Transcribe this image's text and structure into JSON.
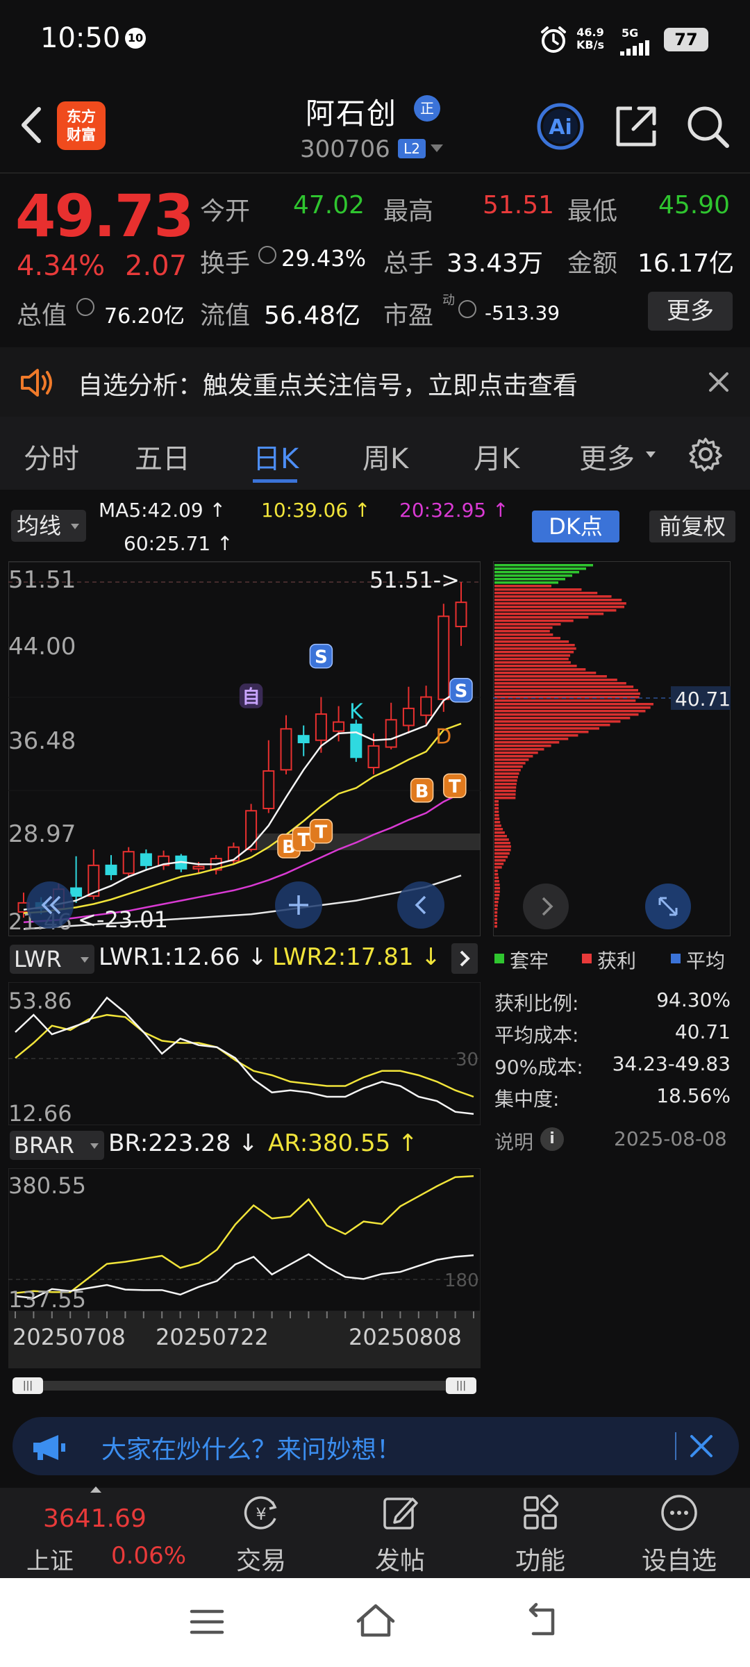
{
  "status_bar": {
    "time": "10:50",
    "badge": "10",
    "net_speed_value": "46.9",
    "net_speed_unit": "KB/s",
    "signal": "5G",
    "battery": "77"
  },
  "header": {
    "logo_line1": "东方",
    "logo_line2": "财富",
    "stock_name": "阿石创",
    "name_badge": "正",
    "stock_code": "300706",
    "level_badge": "L2"
  },
  "quote": {
    "price": "49.73",
    "change_pct": "4.34%",
    "change": "2.07",
    "open_label": "今开",
    "open": "47.02",
    "high_label": "最高",
    "high": "51.51",
    "low_label": "最低",
    "low": "45.90",
    "turnover_label": "换手",
    "turnover": "29.43%",
    "volume_label": "总手",
    "volume": "33.43万",
    "amount_label": "金额",
    "amount": "16.17亿",
    "mktcap_label": "总值",
    "mktcap": "76.20亿",
    "float_label": "流值",
    "float_cap": "56.48亿",
    "pe_label": "市盈",
    "pe_sup": "动",
    "pe": "-513.39",
    "more_label": "更多"
  },
  "banner": {
    "text": "自选分析：触发重点关注信号，立即点击查看"
  },
  "tabs": [
    "分时",
    "五日",
    "日K",
    "周K",
    "月K",
    "更多"
  ],
  "active_tab": 2,
  "ma_row": {
    "select_label": "均线",
    "ma5": "MA5:42.09",
    "ma10": "10:39.06",
    "ma20": "20:32.95",
    "ma60": "60:25.71",
    "up": "↑",
    "dk_label": "DK点",
    "adjust_label": "前复权"
  },
  "kline": {
    "y_labels": [
      "51.51",
      "44.00",
      "36.48",
      "28.97",
      "21.46"
    ],
    "high_marker": "51.51->",
    "low_marker": "<-23.01",
    "markers": [
      "自",
      "S",
      "K",
      "S",
      "B",
      "T",
      "T",
      "B",
      "T",
      "D"
    ],
    "candles": [
      {
        "o": 22.5,
        "c": 23.3,
        "h": 24.2,
        "l": 22.0
      },
      {
        "o": 23.3,
        "c": 22.8,
        "h": 23.8,
        "l": 22.3
      },
      {
        "o": 22.8,
        "c": 24.5,
        "h": 25.0,
        "l": 22.6
      },
      {
        "o": 24.6,
        "c": 23.9,
        "h": 27.4,
        "l": 23.3
      },
      {
        "o": 23.9,
        "c": 26.6,
        "h": 28.0,
        "l": 23.6
      },
      {
        "o": 26.6,
        "c": 25.8,
        "h": 27.5,
        "l": 25.3
      },
      {
        "o": 25.9,
        "c": 27.8,
        "h": 28.2,
        "l": 25.5
      },
      {
        "o": 27.6,
        "c": 26.6,
        "h": 28.0,
        "l": 26.2
      },
      {
        "o": 26.6,
        "c": 27.4,
        "h": 27.9,
        "l": 26.2
      },
      {
        "o": 27.4,
        "c": 26.3,
        "h": 27.6,
        "l": 26.0
      },
      {
        "o": 26.3,
        "c": 26.5,
        "h": 26.9,
        "l": 25.9
      },
      {
        "o": 26.2,
        "c": 27.2,
        "h": 27.5,
        "l": 25.8
      },
      {
        "o": 27.0,
        "c": 28.2,
        "h": 28.6,
        "l": 26.7
      },
      {
        "o": 28.0,
        "c": 31.4,
        "h": 32.0,
        "l": 27.8
      },
      {
        "o": 31.6,
        "c": 34.9,
        "h": 37.6,
        "l": 31.2
      },
      {
        "o": 35.0,
        "c": 38.6,
        "h": 39.8,
        "l": 34.6
      },
      {
        "o": 38.0,
        "c": 37.4,
        "h": 38.9,
        "l": 36.2
      },
      {
        "o": 37.6,
        "c": 39.9,
        "h": 41.4,
        "l": 36.5
      },
      {
        "o": 38.4,
        "c": 39.2,
        "h": 40.6,
        "l": 37.5
      },
      {
        "o": 39.0,
        "c": 36.1,
        "h": 39.4,
        "l": 35.7
      },
      {
        "o": 35.2,
        "c": 37.1,
        "h": 38.2,
        "l": 34.6
      },
      {
        "o": 37.0,
        "c": 39.4,
        "h": 40.9,
        "l": 36.8
      },
      {
        "o": 38.9,
        "c": 40.4,
        "h": 42.3,
        "l": 38.2
      },
      {
        "o": 39.8,
        "c": 41.4,
        "h": 42.4,
        "l": 39.0
      },
      {
        "o": 41.2,
        "c": 48.5,
        "h": 49.6,
        "l": 40.1
      },
      {
        "o": 47.6,
        "c": 49.73,
        "h": 51.51,
        "l": 45.9
      }
    ],
    "ma5": [
      22.7,
      22.9,
      23.2,
      23.5,
      24.2,
      24.8,
      25.6,
      26.2,
      26.7,
      26.9,
      26.7,
      26.7,
      27.1,
      28.3,
      30.1,
      32.6,
      35.0,
      37.1,
      38.2,
      38.3,
      37.6,
      37.7,
      38.3,
      38.9,
      41.1,
      42.09
    ],
    "ma10": [
      22.4,
      22.5,
      22.7,
      22.9,
      23.2,
      23.6,
      24.1,
      24.6,
      25.1,
      25.6,
      25.9,
      26.3,
      26.7,
      27.3,
      28.2,
      29.3,
      30.5,
      31.8,
      32.9,
      33.4,
      34.4,
      35.1,
      35.9,
      36.6,
      38.5,
      39.06
    ],
    "ma20": [
      21.6,
      21.7,
      21.8,
      22.0,
      22.2,
      22.4,
      22.6,
      22.9,
      23.2,
      23.5,
      23.8,
      24.1,
      24.4,
      24.8,
      25.3,
      25.9,
      26.6,
      27.3,
      28.0,
      28.6,
      29.3,
      29.9,
      30.6,
      31.2,
      32.2,
      32.95
    ],
    "ma60": [
      21.0,
      21.1,
      21.2,
      21.3,
      21.4,
      21.5,
      21.6,
      21.7,
      21.8,
      21.9,
      22.0,
      22.1,
      22.2,
      22.3,
      22.5,
      22.7,
      22.9,
      23.1,
      23.3,
      23.5,
      23.8,
      24.1,
      24.4,
      24.7,
      25.2,
      25.71
    ]
  },
  "chips": {
    "avg_cost_marker": "40.71",
    "legend": [
      "套牢",
      "获利",
      "平均"
    ],
    "stats": [
      {
        "label": "获利比例:",
        "value": "94.30%"
      },
      {
        "label": "平均成本:",
        "value": "40.71"
      },
      {
        "label": "90%成本:",
        "value": "34.23-49.83"
      },
      {
        "label": "集中度:",
        "value": "18.56%"
      }
    ],
    "note_label": "说明",
    "date": "2025-08-08"
  },
  "lwr": {
    "select_label": "LWR",
    "lwr1": "LWR1:12.66",
    "lwr2": "LWR2:17.81",
    "down": "↓",
    "y_top": "53.86",
    "y_bottom": "12.66",
    "ref": "30",
    "lwr1_values": [
      40,
      48,
      39,
      42,
      45,
      56,
      49,
      40,
      30,
      37,
      34,
      33,
      28,
      18,
      12,
      13,
      12,
      10,
      10,
      14,
      17,
      15,
      10,
      8,
      3,
      2
    ],
    "lwr2_values": [
      28,
      35,
      43,
      41,
      46,
      48,
      47,
      40,
      36,
      35,
      35,
      33,
      27,
      22,
      20,
      17,
      16,
      15,
      15,
      19,
      22,
      22,
      20,
      17,
      13,
      10
    ]
  },
  "brar": {
    "select_label": "BRAR",
    "br": "BR:223.28",
    "ar": "AR:380.55",
    "br_arrow": "↓",
    "ar_arrow": "↑",
    "y_top": "380.55",
    "y_bottom": "137.55",
    "ref": "180",
    "dates": [
      "20250708",
      "20250722",
      "20250808"
    ],
    "ar_values": [
      148,
      152,
      150,
      150,
      178,
      206,
      210,
      216,
      222,
      198,
      208,
      234,
      284,
      322,
      296,
      300,
      334,
      282,
      265,
      290,
      285,
      320,
      340,
      360,
      378,
      380
    ],
    "br_values": [
      142,
      138,
      156,
      152,
      158,
      164,
      155,
      154,
      154,
      145,
      160,
      172,
      205,
      220,
      185,
      205,
      225,
      200,
      180,
      176,
      186,
      190,
      202,
      214,
      220,
      223
    ]
  },
  "ask_bar": {
    "text": "大家在炒什么？来问妙想！"
  },
  "bottom_nav": {
    "index_value": "3641.69",
    "index_name": "上证",
    "index_change": "0.06%",
    "items": [
      "交易",
      "发帖",
      "功能",
      "设自选"
    ]
  }
}
